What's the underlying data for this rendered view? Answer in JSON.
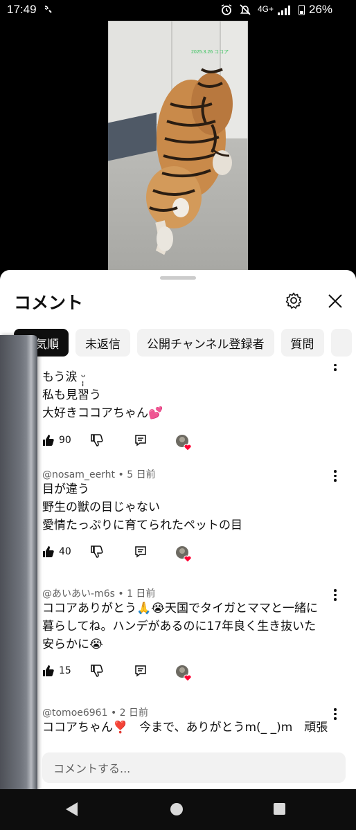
{
  "status_bar": {
    "time": "17:49",
    "network": "4G+",
    "battery": "26%",
    "icons": [
      "wifi-calling-icon",
      "alarm-icon",
      "mute-icon",
      "signal-icon",
      "battery-icon"
    ]
  },
  "video": {
    "overlay_text": "2025.3.26  ココア",
    "subject": "tiger"
  },
  "sheet": {
    "title": "コメント",
    "settings_icon": "gear-icon",
    "close_icon": "close-icon"
  },
  "chips": [
    {
      "label": "人気順",
      "active": true
    },
    {
      "label": "未返信",
      "active": false
    },
    {
      "label": "公開チャンネル登録者",
      "active": false
    },
    {
      "label": "質問",
      "active": false
    }
  ],
  "comments": [
    {
      "author": "",
      "age": "",
      "lines": [
        "もう涙 ᵕ̩̩",
        "私も見習う",
        "大好きココアちゃん💕"
      ],
      "likes": "90"
    },
    {
      "author": "@nosam_eerht",
      "age": "5 日前",
      "lines": [
        "目が違う",
        "野生の獣の目じゃない",
        "愛情たっぷりに育てられたペットの目"
      ],
      "likes": "40"
    },
    {
      "author": "@あいあい-m6s",
      "age": "1 日前",
      "lines": [
        "ココアありがとう🙏😭天国でタイガとママと一緒に",
        "暮らしてね。ハンデがあるのに17年良く生き抜いた",
        "安らかに😭"
      ],
      "likes": "15"
    },
    {
      "author": "@tomoe6961",
      "age": "2 日前",
      "lines": [
        "ココアちゃん❣️　今まで、ありがとうm(_ _)m　頑張"
      ],
      "likes": ""
    }
  ],
  "input": {
    "placeholder": "コメントする..."
  },
  "colors": {
    "chip_active_bg": "#0f0f0f",
    "chip_bg": "#f2f2f2",
    "heart": "#ff0033"
  }
}
